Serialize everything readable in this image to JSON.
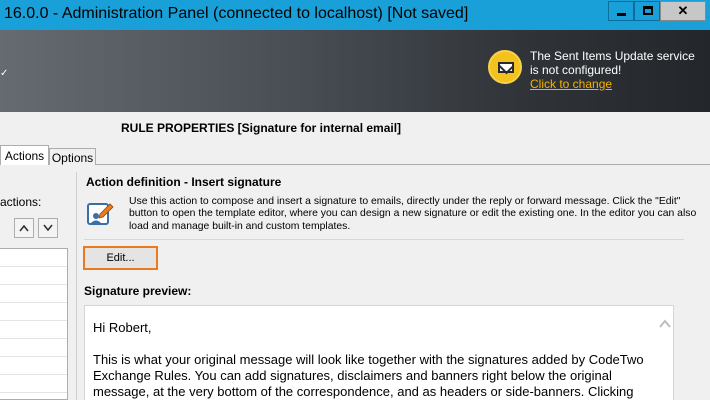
{
  "window": {
    "title": "16.0.0 - Administration Panel (connected to localhost) [Not saved]",
    "minimize_glyph": "",
    "close_glyph": "✕"
  },
  "notice": {
    "line1": "The Sent Items Update service",
    "line2": "is not configured!",
    "link": "Click to change",
    "icon": "mail-warning-icon",
    "link_color": "#f5b400"
  },
  "rule": {
    "heading": "RULE PROPERTIES [Signature for internal email]"
  },
  "tabs": [
    {
      "label": "Actions",
      "active": true
    },
    {
      "label": "Options",
      "active": false
    }
  ],
  "left_panel": {
    "label": "actions:"
  },
  "action": {
    "title": "Action definition - Insert signature",
    "description": "Use this action to compose and insert a signature to emails, directly under the reply or forward message. Click the \"Edit\" button to open the template editor, where you can design a new signature or edit the existing one. In the editor you can also load and manage built-in and custom templates.",
    "edit_button": "Edit...",
    "edit_border_color": "#e97a1f"
  },
  "preview": {
    "label": "Signature preview:",
    "greeting": "Hi Robert,",
    "body": "This is what your original message will look like together with the signatures added by CodeTwo Exchange Rules. You can add signatures, disclaimers and banners right below the original message, at the very bottom of the correspondence, and as headers or side-banners. Clicking"
  },
  "colors": {
    "titlebar": "#19a0d8",
    "banner_dark": "#23272b"
  }
}
